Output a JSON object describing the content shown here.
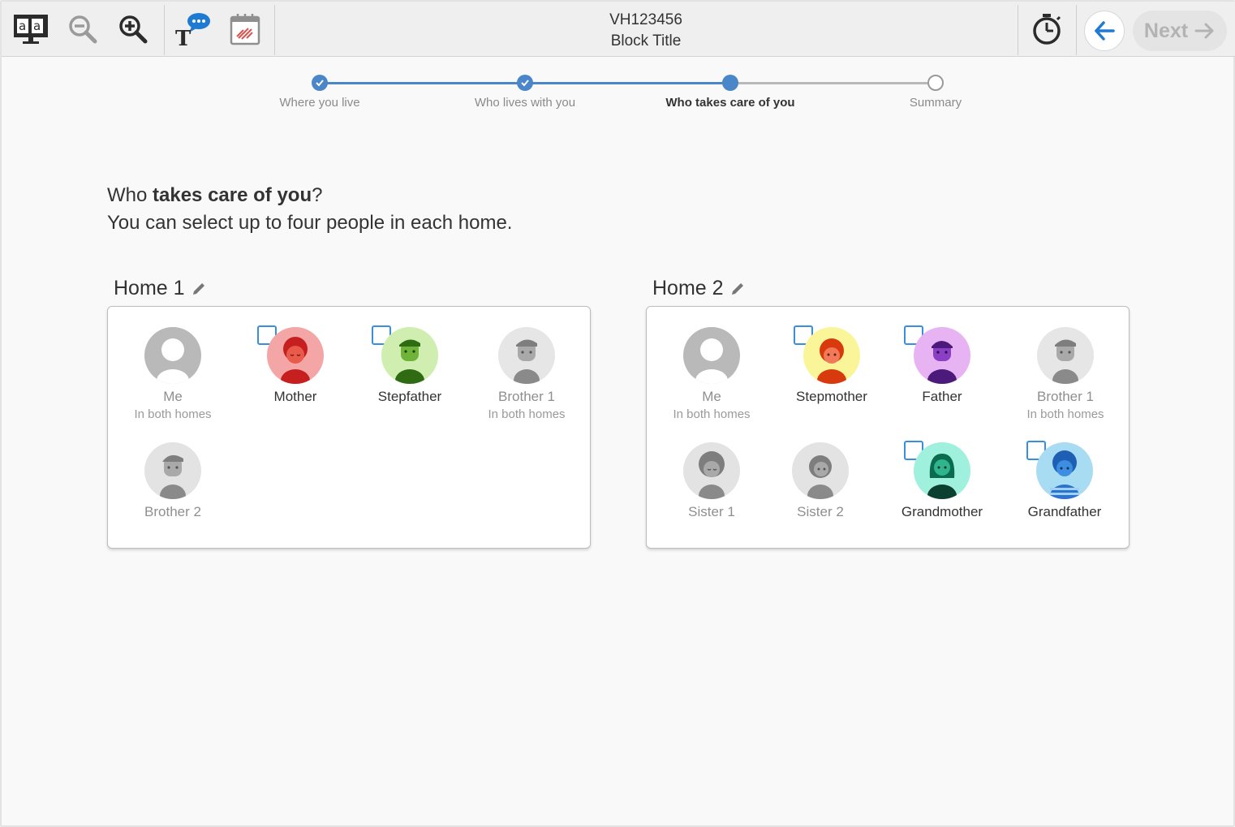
{
  "toolbar": {
    "icons": [
      "translate-icon",
      "zoom-out-icon",
      "zoom-in-icon",
      "text-to-speech-icon",
      "calendar-icon",
      "timer-icon",
      "back-arrow-icon",
      "next-arrow-icon"
    ],
    "block_id": "VH123456",
    "block_title": "Block Title",
    "next_label": "Next"
  },
  "progress": {
    "steps": [
      {
        "label": "Where you live",
        "state": "complete"
      },
      {
        "label": "Who lives with you",
        "state": "complete"
      },
      {
        "label": "Who takes care of you",
        "state": "current"
      },
      {
        "label": "Summary",
        "state": "upcoming"
      }
    ]
  },
  "question": {
    "prefix": "Who ",
    "bold": "takes care of you",
    "suffix": "?",
    "instruction": "You can select up to four people in each home."
  },
  "homes": [
    {
      "title": "Home 1",
      "people": [
        {
          "name": "Me",
          "sub": "In both homes",
          "selectable": false
        },
        {
          "name": "Mother",
          "sub": "",
          "selectable": true,
          "color": "#f4a6a6"
        },
        {
          "name": "Stepfather",
          "sub": "",
          "selectable": true,
          "color": "#cfeeb0"
        },
        {
          "name": "Brother 1",
          "sub": "In both homes",
          "selectable": false
        },
        {
          "name": "Brother 2",
          "sub": "",
          "selectable": false
        }
      ]
    },
    {
      "title": "Home 2",
      "people": [
        {
          "name": "Me",
          "sub": "In both homes",
          "selectable": false
        },
        {
          "name": "Stepmother",
          "sub": "",
          "selectable": true,
          "color": "#fbf59a"
        },
        {
          "name": "Father",
          "sub": "",
          "selectable": true,
          "color": "#e7b3f2"
        },
        {
          "name": "Brother 1",
          "sub": "In both homes",
          "selectable": false
        },
        {
          "name": "Sister 1",
          "sub": "",
          "selectable": false
        },
        {
          "name": "Sister 2",
          "sub": "",
          "selectable": false
        },
        {
          "name": "Grandmother",
          "sub": "",
          "selectable": true,
          "color": "#9ff0dc"
        },
        {
          "name": "Grandfather",
          "sub": "",
          "selectable": true,
          "color": "#a7dcf3"
        }
      ]
    }
  ],
  "colors": {
    "accent": "#4a86c8",
    "progress_done": "#4a86c8",
    "progress_todo": "#b8b8b8"
  }
}
